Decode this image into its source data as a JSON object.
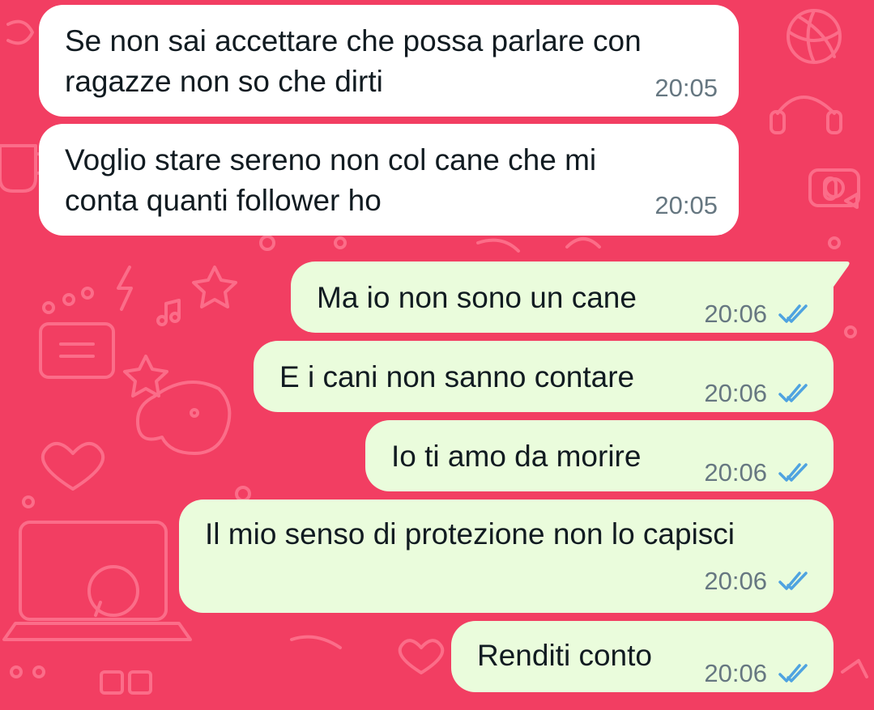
{
  "colors": {
    "background": "#f23e62",
    "incoming_bubble": "#ffffff",
    "outgoing_bubble": "#eafcdc",
    "read_ticks": "#4fa3e0",
    "timestamp": "#667781"
  },
  "wallpaper": {
    "icons": [
      "basketball-icon",
      "headphones-icon",
      "camera-icon",
      "microphone-icon",
      "star-icon",
      "heart-icon",
      "dog-icon",
      "laptop-icon",
      "whatsapp-logo-icon",
      "chat-icon",
      "lightning-icon",
      "music-note-icon",
      "coffee-cup-icon"
    ]
  },
  "messages": [
    {
      "direction": "in",
      "lines": [
        "Se non sai accettare che possa parlare con",
        "ragazze non so che dirti"
      ],
      "time": "20:05"
    },
    {
      "direction": "in",
      "lines": [
        "Voglio stare sereno non col cane che mi",
        "conta quanti follower ho"
      ],
      "time": "20:05"
    },
    {
      "direction": "out",
      "lines": [
        "Ma io non sono un cane"
      ],
      "time": "20:06",
      "status": "read"
    },
    {
      "direction": "out",
      "lines": [
        "E i cani non sanno contare"
      ],
      "time": "20:06",
      "status": "read"
    },
    {
      "direction": "out",
      "lines": [
        "Io ti amo da morire"
      ],
      "time": "20:06",
      "status": "read"
    },
    {
      "direction": "out",
      "lines": [
        "Il mio senso di protezione non lo capisci"
      ],
      "time": "20:06",
      "status": "read"
    },
    {
      "direction": "out",
      "lines": [
        "Renditi conto"
      ],
      "time": "20:06",
      "status": "read"
    }
  ]
}
